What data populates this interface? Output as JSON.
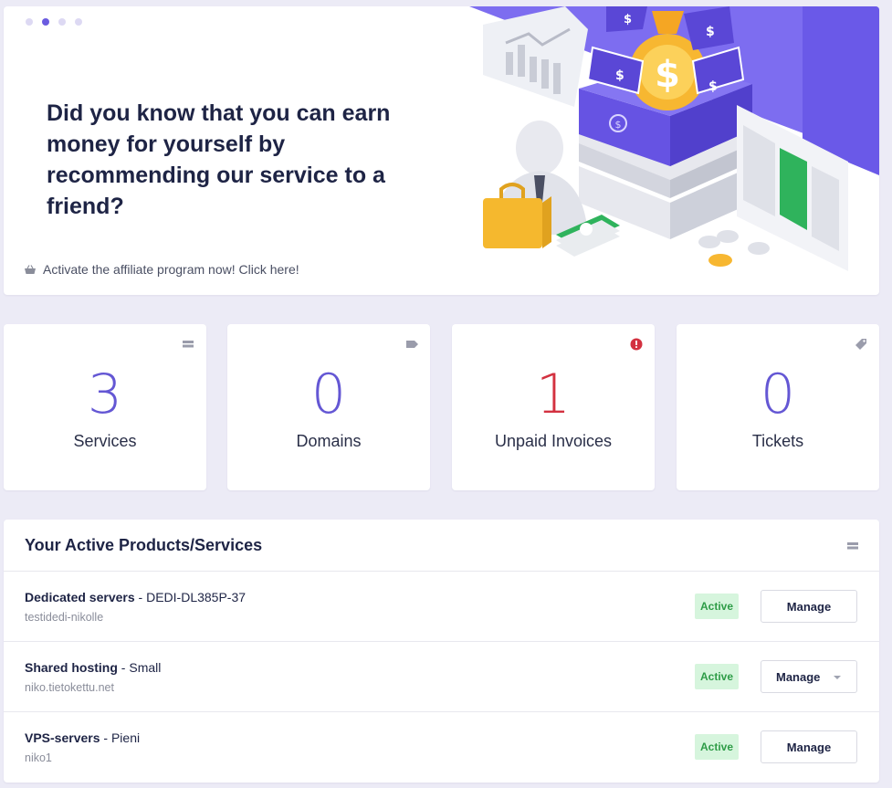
{
  "hero": {
    "title": "Did you know that you can earn money for yourself by recommending our service to a friend?",
    "link": "Activate the affiliate program now! Click here!",
    "slides": [
      1,
      2,
      3,
      4
    ],
    "active_slide": 2
  },
  "stats": [
    {
      "value": "3",
      "label": "Services",
      "icon": "server-icon"
    },
    {
      "value": "0",
      "label": "Domains",
      "icon": "tag-icon"
    },
    {
      "value": "1",
      "label": "Unpaid Invoices",
      "icon": "alert-icon"
    },
    {
      "value": "0",
      "label": "Tickets",
      "icon": "ticket-icon"
    }
  ],
  "products": {
    "title": "Your Active Products/Services",
    "items": [
      {
        "category": "Dedicated servers",
        "plan": "DEDI-DL385P-37",
        "host": "testidedi-nikolle",
        "status": "Active",
        "action": "Manage"
      },
      {
        "category": "Shared hosting",
        "plan": "Small",
        "host": "niko.tietokettu.net",
        "status": "Active",
        "action": "Manage"
      },
      {
        "category": "VPS-servers",
        "plan": "Pieni",
        "host": "niko1",
        "status": "Active",
        "action": "Manage"
      }
    ]
  },
  "colors": {
    "accent": "#6457d4",
    "danger": "#d33140",
    "success": "#2e9c47",
    "background": "#ecebf6"
  }
}
